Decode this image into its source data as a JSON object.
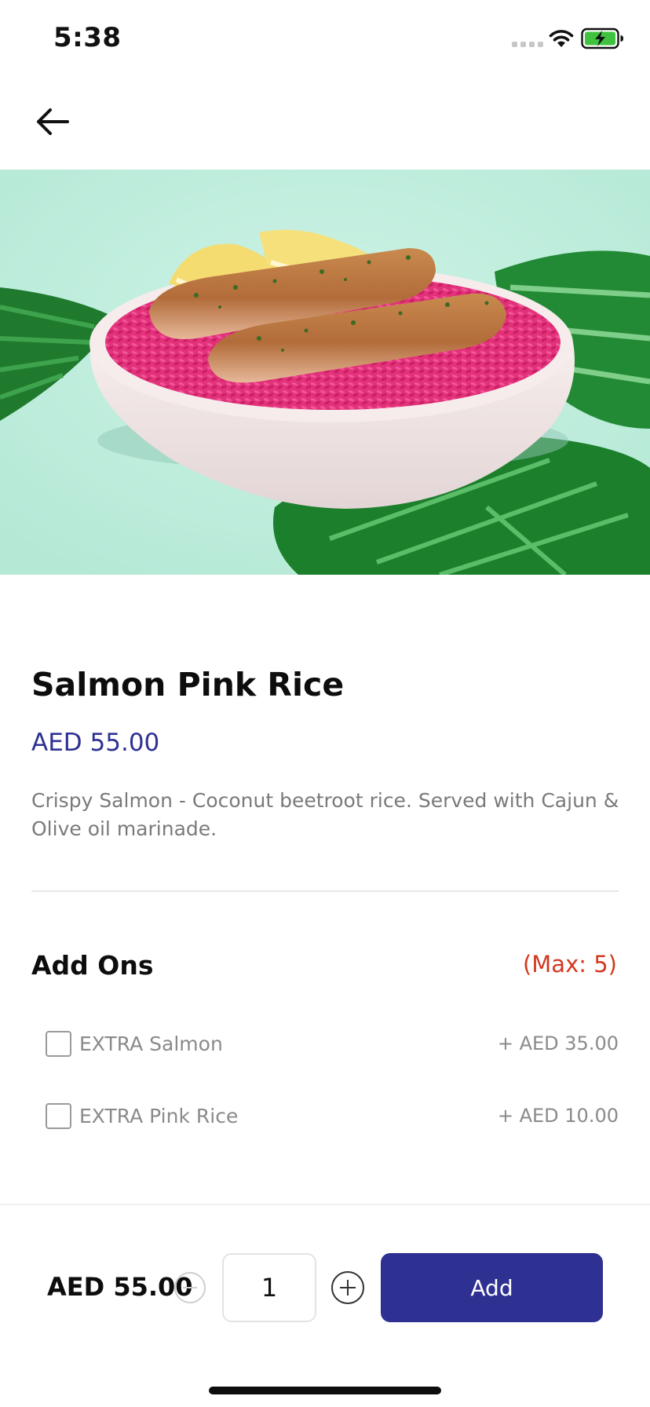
{
  "status_bar": {
    "time": "5:38",
    "icons": [
      "signal-icon",
      "wifi-icon",
      "battery-charging-icon"
    ],
    "battery_color": "#3fc33f"
  },
  "nav": {
    "back_icon": "arrow-left-icon"
  },
  "hero": {
    "image_subject": "salmon fillets on pink rice bowl with lemon, mint background and palm leaves"
  },
  "product": {
    "title": "Salmon Pink Rice",
    "price": "AED 55.00",
    "description": "Crispy Salmon - Coconut beetroot rice. Served with Cajun & Olive oil marinade."
  },
  "addons": {
    "title": "Add Ons",
    "max_label": "(Max: 5)",
    "items": [
      {
        "name": "EXTRA Salmon",
        "price": "+ AED 35.00",
        "checked": false
      },
      {
        "name": "EXTRA Pink Rice",
        "price": "+ AED 10.00",
        "checked": false
      }
    ]
  },
  "cart_bar": {
    "total": "AED 55.00",
    "quantity": "1",
    "add_label": "Add"
  },
  "colors": {
    "accent": "#2e3192",
    "max_label": "#d2391f",
    "hero_background": "#bfeedd"
  }
}
